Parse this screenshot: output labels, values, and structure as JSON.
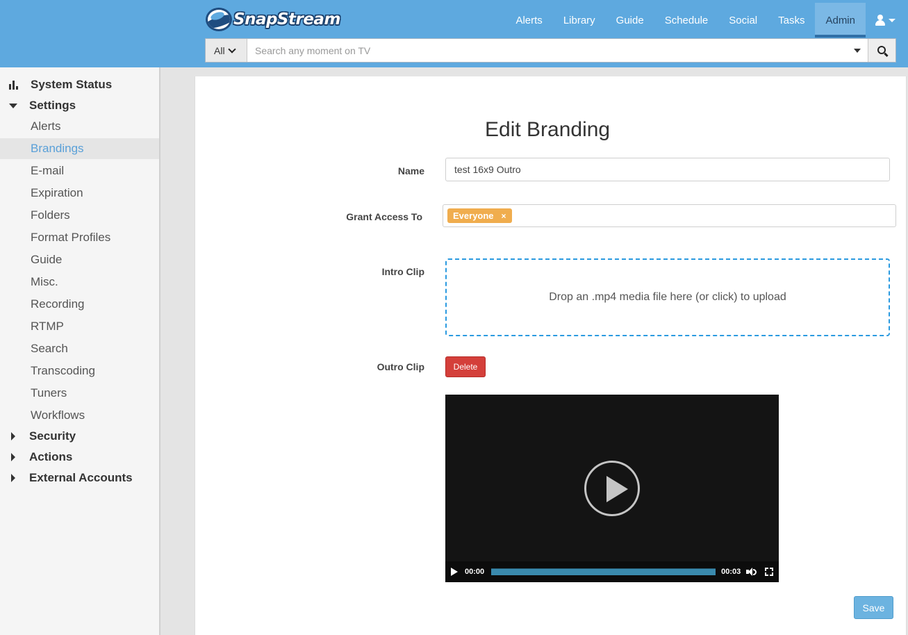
{
  "brand": {
    "name": "SnapStream"
  },
  "nav": {
    "items": [
      {
        "label": "Alerts"
      },
      {
        "label": "Library"
      },
      {
        "label": "Guide"
      },
      {
        "label": "Schedule"
      },
      {
        "label": "Social"
      },
      {
        "label": "Tasks"
      },
      {
        "label": "Admin",
        "active": true
      }
    ],
    "user_icon": "user-icon"
  },
  "search": {
    "scope": "All",
    "placeholder": "Search any moment on TV",
    "button_icon": "search-icon"
  },
  "sidebar": {
    "system_status": "System Status",
    "settings": "Settings",
    "settings_items": [
      {
        "label": "Alerts"
      },
      {
        "label": "Brandings",
        "selected": true
      },
      {
        "label": "E-mail"
      },
      {
        "label": "Expiration"
      },
      {
        "label": "Folders"
      },
      {
        "label": "Format Profiles"
      },
      {
        "label": "Guide"
      },
      {
        "label": "Misc."
      },
      {
        "label": "Recording"
      },
      {
        "label": "RTMP"
      },
      {
        "label": "Search"
      },
      {
        "label": "Transcoding"
      },
      {
        "label": "Tuners"
      },
      {
        "label": "Workflows"
      }
    ],
    "security": "Security",
    "actions": "Actions",
    "external_accounts": "External Accounts"
  },
  "form": {
    "title": "Edit Branding",
    "name_label": "Name",
    "name_value": "test 16x9 Outro",
    "access_label": "Grant Access To",
    "access_tag": "Everyone",
    "access_tag_remove": "×",
    "intro_label": "Intro Clip",
    "intro_dropzone": "Drop an .mp4 media file here (or click) to upload",
    "outro_label": "Outro Clip",
    "delete_label": "Delete",
    "video": {
      "current_time": "00:00",
      "duration": "00:03"
    },
    "save_label": "Save"
  },
  "colors": {
    "header": "#5ea9df",
    "tag": "#f0ad4e",
    "delete": "#d43f3a",
    "save": "#6cb3e0",
    "dropzone_border": "#2a9ae0",
    "selected_text": "#5aa0d8"
  }
}
